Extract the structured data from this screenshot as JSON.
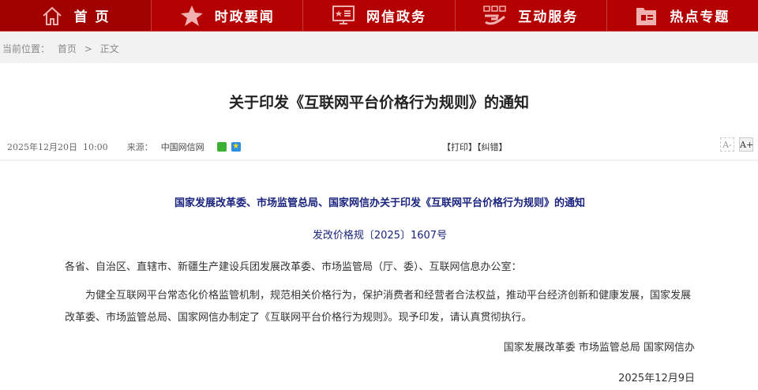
{
  "nav": [
    {
      "label": "首 页",
      "icon": "home-icon"
    },
    {
      "label": "时政要闻",
      "icon": "star-icon"
    },
    {
      "label": "网信政务",
      "icon": "monitor-icon"
    },
    {
      "label": "互动服务",
      "icon": "hand-icon"
    },
    {
      "label": "热点专题",
      "icon": "folder-icon"
    }
  ],
  "breadcrumb": {
    "prefix": "当前位置：",
    "home": "首页",
    "sep": ">",
    "current": "正文"
  },
  "article": {
    "title": "关于印发《互联网平台价格行为规则》的通知",
    "date": "2025年12月20日  10:00",
    "source_label": "来源：",
    "source": "中国网信网",
    "print": "【打印】",
    "correct": "【纠错】",
    "font_smaller": "A-",
    "font_larger": "A+",
    "heading": "国家发展改革委、市场监管总局、国家网信办关于印发《互联网平台价格行为规则》的通知",
    "doc_no": "发改价格规〔2025〕1607号",
    "addressee": "各省、自治区、直辖市、新疆生产建设兵团发展改革委、市场监管局（厅、委）、互联网信息办公室：",
    "paragraph": "为健全互联网平台常态化价格监管机制，规范相关价格行为，保护消费者和经营者合法权益，推动平台经济创新和健康发展，国家发展改革委、市场监管总局、国家网信办制定了《互联网平台价格行为规则》。现予印发，请认真贯彻执行。",
    "signature": "国家发展改革委 市场监管总局 国家网信办",
    "sign_date": "2025年12月9日"
  },
  "colors": {
    "nav": "#b40000",
    "nav_active": "#a00000",
    "heading": "#1a237e"
  }
}
